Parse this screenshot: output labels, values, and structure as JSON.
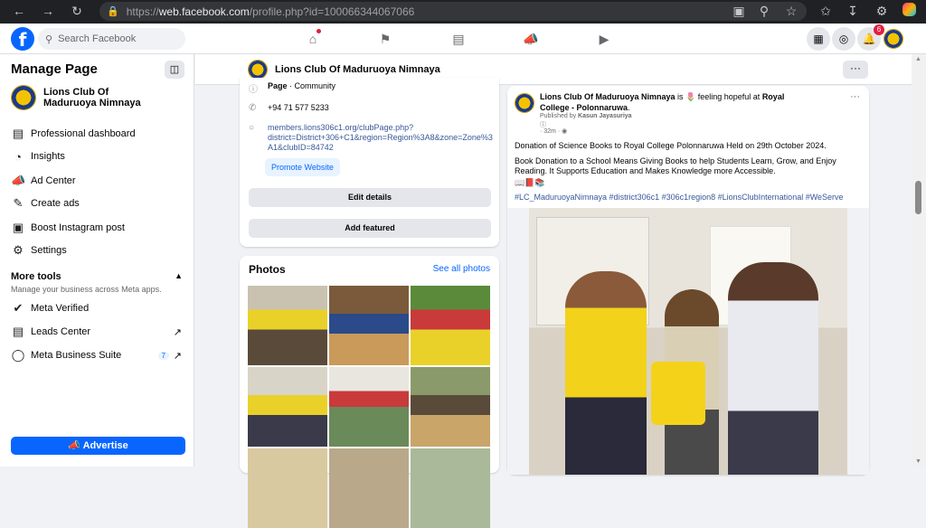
{
  "browser": {
    "url_prefix": "https://",
    "url_domain": "web.facebook.com",
    "url_path": "/profile.php?id=100066344067066"
  },
  "topbar": {
    "search_placeholder": "Search Facebook",
    "notification_count": "6"
  },
  "sidebar": {
    "title": "Manage Page",
    "page_name": "Lions Club Of Maduruoya Nimnaya",
    "items": [
      {
        "label": "Professional dashboard",
        "icon": "dashboard-icon"
      },
      {
        "label": "Insights",
        "icon": "insights-icon"
      },
      {
        "label": "Ad Center",
        "icon": "megaphone-icon"
      },
      {
        "label": "Create ads",
        "icon": "edit-icon"
      },
      {
        "label": "Boost Instagram post",
        "icon": "instagram-icon"
      },
      {
        "label": "Settings",
        "icon": "gear-icon"
      }
    ],
    "more_tools_title": "More tools",
    "more_tools_sub": "Manage your business across Meta apps.",
    "tools": [
      {
        "label": "Meta Verified",
        "icon": "verified-icon"
      },
      {
        "label": "Leads Center",
        "icon": "leads-icon"
      },
      {
        "label": "Meta Business Suite",
        "icon": "meta-icon",
        "count": "7"
      }
    ],
    "advertise_label": "Advertise"
  },
  "page_header": {
    "name": "Lions Club Of Maduruoya Nimnaya",
    "more": "···"
  },
  "intro": {
    "category_prefix": "Page",
    "category": " · Community",
    "phone": "+94 71 577 5233",
    "website_line1": "members.lions306c1.org/clubPage.php?",
    "website_line2": "district=District+306+C1&region=Region%3A8&zone=Zone%3",
    "website_line3": "A1&clubID=84742",
    "promote_label": "Promote Website",
    "edit_details_label": "Edit details",
    "add_featured_label": "Add featured"
  },
  "photos": {
    "title": "Photos",
    "see_all": "See all photos"
  },
  "post": {
    "author": "Lions Club Of Maduruoya Nimnaya",
    "is_text": " is ",
    "feeling": " feeling hopeful at ",
    "location": "Royal College - Polonnaruwa",
    "published_by": "Published by ",
    "publisher": "Kasun Jayasuriya",
    "time": "· 32m ·",
    "line1": "Donation of Science Books to Royal College Polonnaruwa Held on 29th October 2024.",
    "line2": "Book Donation to a School Means Giving Books to help Students Learn, Grow, and Enjoy Reading. It Supports Education and Makes Knowledge more Accessible.",
    "emoji_line": "📖📕📚",
    "tags": "#LC_MaduruoyaNimnaya #district306c1 #306c1region8 #LionsClubInternational #WeServe"
  },
  "colors": {
    "brand": "#0866ff",
    "link": "#385898",
    "background": "#f0f2f5"
  }
}
